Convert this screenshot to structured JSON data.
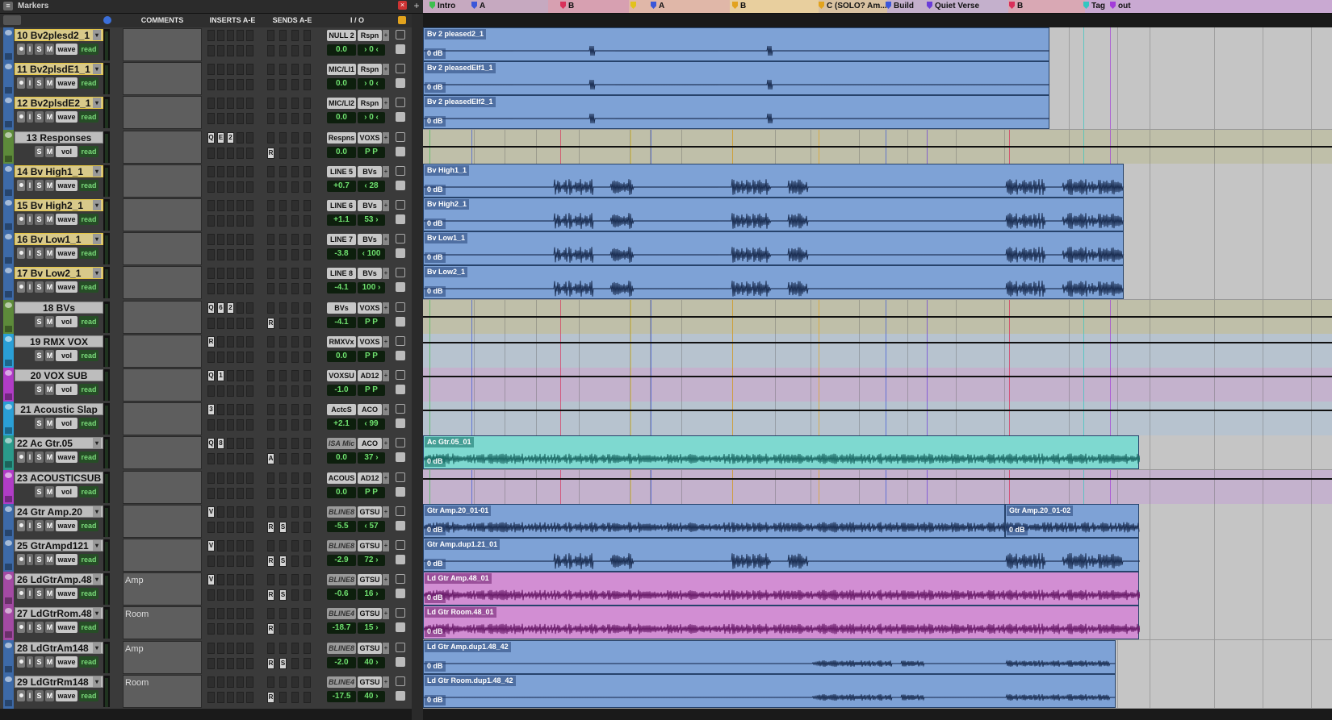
{
  "window": {
    "title": "Markers"
  },
  "markers": [
    {
      "label": "Intro",
      "color": "#3fbf4f"
    },
    {
      "label": "A",
      "color": "#3b57d9"
    },
    {
      "label": "B",
      "color": "#d9305a"
    },
    {
      "label": "",
      "color": "#e2c21d"
    },
    {
      "label": "A",
      "color": "#3b57d9"
    },
    {
      "label": "B",
      "color": "#e2a31d"
    },
    {
      "label": "C (SOLO? Am...",
      "color": "#e2a31d"
    },
    {
      "label": "Build",
      "color": "#3b57d9"
    },
    {
      "label": "Quiet Verse",
      "color": "#6a3bd9"
    },
    {
      "label": "B",
      "color": "#d9305a"
    },
    {
      "label": "Tag",
      "color": "#33c7c0"
    },
    {
      "label": "out",
      "color": "#a33bd9"
    }
  ],
  "header": {
    "comments": "COMMENTS",
    "inserts": "INSERTS A-E",
    "sends": "SENDS A-E",
    "io": "I / O"
  },
  "tracks": [
    {
      "num": "10",
      "name": "Bv2plesd2_1",
      "type": "audio",
      "color": "#3d6aa8",
      "view": "wave",
      "auto": "read",
      "comment": "",
      "ins": [
        "",
        "",
        "",
        "",
        ""
      ],
      "sends": [
        "",
        "",
        "",
        ""
      ],
      "input": "NULL 2",
      "output": "Rspn",
      "vol": "0.0",
      "pan": "› 0 ‹",
      "clips": [
        {
          "name": "Bv 2 pleased2_1",
          "gain": "0 dB",
          "style": "blue",
          "wave": "sparse"
        }
      ]
    },
    {
      "num": "11",
      "name": "Bv2plsdE1_1",
      "type": "audio",
      "color": "#3d6aa8",
      "view": "wave",
      "auto": "read",
      "comment": "",
      "ins": [
        "",
        "",
        "",
        "",
        ""
      ],
      "sends": [
        "",
        "",
        "",
        ""
      ],
      "input": "MIC/LI1",
      "output": "Rspn",
      "vol": "0.0",
      "pan": "› 0 ‹",
      "clips": [
        {
          "name": "Bv 2 pleasedElf1_1",
          "gain": "0 dB",
          "style": "blue",
          "wave": "sparse"
        }
      ]
    },
    {
      "num": "12",
      "name": "Bv2plsdE2_1",
      "type": "audio",
      "color": "#3d6aa8",
      "view": "wave",
      "auto": "read",
      "comment": "",
      "ins": [
        "",
        "",
        "",
        "",
        ""
      ],
      "sends": [
        "",
        "",
        "",
        ""
      ],
      "input": "MIC/LI2",
      "output": "Rspn",
      "vol": "0.0",
      "pan": "› 0 ‹",
      "clips": [
        {
          "name": "Bv 2 pleasedElf2_1",
          "gain": "0 dB",
          "style": "blue",
          "wave": "sparse"
        }
      ]
    },
    {
      "num": "13",
      "name": "Responses",
      "type": "aux",
      "color": "#5d8a3a",
      "view": "vol",
      "auto": "read",
      "comment": "",
      "ins": [
        "Q",
        "E",
        "2",
        "",
        ""
      ],
      "sends": [
        "R",
        "",
        "",
        ""
      ],
      "input": "Respns",
      "output": "VOXS",
      "vol": "0.0",
      "pan": "P P",
      "clips": []
    },
    {
      "num": "14",
      "name": "Bv High1_1",
      "type": "audio",
      "color": "#3d6aa8",
      "view": "wave",
      "auto": "read",
      "comment": "",
      "ins": [
        "",
        "",
        "",
        "",
        ""
      ],
      "sends": [
        "",
        "",
        "",
        ""
      ],
      "input": "LINE 5",
      "output": "BVs",
      "vol": "+0.7",
      "pan": "‹ 28",
      "clips": [
        {
          "name": "Bv High1_1",
          "gain": "0 dB",
          "style": "blue",
          "wave": "phrases"
        }
      ]
    },
    {
      "num": "15",
      "name": "Bv High2_1",
      "type": "audio",
      "color": "#3d6aa8",
      "view": "wave",
      "auto": "read",
      "comment": "",
      "ins": [
        "",
        "",
        "",
        "",
        ""
      ],
      "sends": [
        "",
        "",
        "",
        ""
      ],
      "input": "LINE 6",
      "output": "BVs",
      "vol": "+1.1",
      "pan": "53 ›",
      "clips": [
        {
          "name": "Bv High2_1",
          "gain": "0 dB",
          "style": "blue",
          "wave": "phrases"
        }
      ]
    },
    {
      "num": "16",
      "name": "Bv Low1_1",
      "type": "audio",
      "color": "#3d6aa8",
      "view": "wave",
      "auto": "read",
      "comment": "",
      "ins": [
        "",
        "",
        "",
        "",
        ""
      ],
      "sends": [
        "",
        "",
        "",
        ""
      ],
      "input": "LINE 7",
      "output": "BVs",
      "vol": "-3.8",
      "pan": "‹ 100",
      "clips": [
        {
          "name": "Bv Low1_1",
          "gain": "0 dB",
          "style": "blue",
          "wave": "phrases"
        }
      ]
    },
    {
      "num": "17",
      "name": "Bv Low2_1",
      "type": "audio",
      "color": "#3d6aa8",
      "view": "wave",
      "auto": "read",
      "comment": "",
      "ins": [
        "",
        "",
        "",
        "",
        ""
      ],
      "sends": [
        "",
        "",
        "",
        ""
      ],
      "input": "LINE 8",
      "output": "BVs",
      "vol": "-4.1",
      "pan": "100 ›",
      "clips": [
        {
          "name": "Bv Low2_1",
          "gain": "0 dB",
          "style": "blue",
          "wave": "phrases"
        }
      ]
    },
    {
      "num": "18",
      "name": "BVs",
      "type": "aux",
      "color": "#5d8a3a",
      "view": "vol",
      "auto": "read",
      "comment": "",
      "ins": [
        "Q",
        "6",
        "2",
        "",
        ""
      ],
      "sends": [
        "R",
        "",
        "",
        ""
      ],
      "input": "BVs",
      "output": "VOXS",
      "vol": "-4.1",
      "pan": "P P",
      "clips": []
    },
    {
      "num": "19",
      "name": "RMX VOX",
      "type": "aux",
      "color": "#2a9fd6",
      "view": "vol",
      "auto": "read",
      "comment": "",
      "ins": [
        "R",
        "",
        "",
        "",
        ""
      ],
      "sends": [
        "",
        "",
        "",
        ""
      ],
      "input": "RMXVx",
      "output": "VOXS",
      "vol": "0.0",
      "pan": "P P",
      "clips": []
    },
    {
      "num": "20",
      "name": "VOX SUB",
      "type": "aux",
      "color": "#b03cc6",
      "view": "vol",
      "auto": "read",
      "comment": "",
      "ins": [
        "Q",
        "1",
        "",
        "",
        ""
      ],
      "sends": [
        "",
        "",
        "",
        ""
      ],
      "input": "VOXSU",
      "output": "AD12",
      "vol": "-1.0",
      "pan": "P P",
      "clips": []
    },
    {
      "num": "21",
      "name": "Acoustic Slap",
      "type": "aux",
      "color": "#2a9fd6",
      "view": "vol",
      "auto": "read",
      "comment": "",
      "ins": [
        "3",
        "",
        "",
        "",
        ""
      ],
      "sends": [
        "",
        "",
        "",
        ""
      ],
      "input": "ActcS",
      "output": "ACO",
      "vol": "+2.1",
      "pan": "‹ 99",
      "clips": []
    },
    {
      "num": "22",
      "name": "Ac Gtr.05",
      "type": "audio",
      "color": "#2a9a8a",
      "view": "wave",
      "auto": "read",
      "comment": "",
      "ins": [
        "Q",
        "8",
        "",
        "",
        ""
      ],
      "sends": [
        "A",
        "",
        "",
        ""
      ],
      "input": "ISA Mic",
      "output": "ACO",
      "vol": "0.0",
      "pan": "37 ›",
      "clips": [
        {
          "name": "Ac Gtr.05_01",
          "gain": "0 dB",
          "style": "teal",
          "wave": "dense"
        }
      ]
    },
    {
      "num": "23",
      "name": "ACOUSTICSUB",
      "type": "aux",
      "color": "#b03cc6",
      "view": "vol",
      "auto": "read",
      "comment": "",
      "ins": [
        "",
        "",
        "",
        "",
        ""
      ],
      "sends": [
        "",
        "",
        "",
        ""
      ],
      "input": "ACOUS",
      "output": "AD12",
      "vol": "0.0",
      "pan": "P P",
      "clips": []
    },
    {
      "num": "24",
      "name": "Gtr Amp.20",
      "type": "audio",
      "color": "#3d6aa8",
      "view": "wave",
      "auto": "read",
      "comment": "",
      "ins": [
        "V",
        "",
        "",
        "",
        ""
      ],
      "sends": [
        "R",
        "S",
        "",
        ""
      ],
      "input": "BLINE8",
      "output": "GTSU",
      "vol": "-5.5",
      "pan": "‹ 57",
      "clips": [
        {
          "name": "Gtr Amp.20_01-01",
          "gain": "0 dB",
          "style": "blue",
          "wave": "dense"
        },
        {
          "name": "Gtr Amp.20_01-02",
          "gain": "0 dB",
          "style": "blue",
          "wave": "dense"
        }
      ]
    },
    {
      "num": "25",
      "name": "GtrAmpd121",
      "type": "audio",
      "color": "#3d6aa8",
      "view": "wave",
      "auto": "read",
      "comment": "",
      "ins": [
        "V",
        "",
        "",
        "",
        ""
      ],
      "sends": [
        "R",
        "S",
        "",
        ""
      ],
      "input": "BLINE8",
      "output": "GTSU",
      "vol": "-2.9",
      "pan": "72 ›",
      "clips": [
        {
          "name": "Gtr Amp.dup1.21_01",
          "gain": "0 dB",
          "style": "blue",
          "wave": "phrases"
        }
      ]
    },
    {
      "num": "26",
      "name": "LdGtrAmp.48",
      "type": "audio",
      "color": "#a34aa3",
      "view": "wave",
      "auto": "read",
      "comment": "Amp",
      "ins": [
        "V",
        "",
        "",
        "",
        ""
      ],
      "sends": [
        "R",
        "S",
        "",
        ""
      ],
      "input": "BLINE8",
      "output": "GTSU",
      "vol": "-0.6",
      "pan": "16 ›",
      "clips": [
        {
          "name": "Ld Gtr Amp.48_01",
          "gain": "0 dB",
          "style": "purple",
          "wave": "dense"
        }
      ]
    },
    {
      "num": "27",
      "name": "LdGtrRom.48",
      "type": "audio",
      "color": "#a34aa3",
      "view": "wave",
      "auto": "read",
      "comment": "Room",
      "ins": [
        "",
        "",
        "",
        "",
        ""
      ],
      "sends": [
        "R",
        "",
        "",
        ""
      ],
      "input": "BLINE4",
      "output": "GTSU",
      "vol": "-18.7",
      "pan": "15 ›",
      "clips": [
        {
          "name": "Ld Gtr Room.48_01",
          "gain": "0 dB",
          "style": "purple",
          "wave": "dense"
        }
      ]
    },
    {
      "num": "28",
      "name": "LdGtrAm148",
      "type": "audio",
      "color": "#3d6aa8",
      "view": "wave",
      "auto": "read",
      "comment": "Amp",
      "ins": [
        "",
        "",
        "",
        "",
        ""
      ],
      "sends": [
        "R",
        "S",
        "",
        ""
      ],
      "input": "BLINE8",
      "output": "GTSU",
      "vol": "-2.0",
      "pan": "40 ›",
      "clips": [
        {
          "name": "Ld Gtr Amp.dup1.48_42",
          "gain": "0 dB",
          "style": "blue",
          "wave": "late"
        }
      ]
    },
    {
      "num": "29",
      "name": "LdGtrRm148",
      "type": "audio",
      "color": "#3d6aa8",
      "view": "wave",
      "auto": "read",
      "comment": "Room",
      "ins": [
        "",
        "",
        "",
        "",
        ""
      ],
      "sends": [
        "R",
        "",
        "",
        ""
      ],
      "input": "BLINE4",
      "output": "GTSU",
      "vol": "-17.5",
      "pan": "40 ›",
      "clips": [
        {
          "name": "Ld Gtr Room.dup1.48_42",
          "gain": "0 dB",
          "style": "blue",
          "wave": "late"
        }
      ]
    }
  ]
}
